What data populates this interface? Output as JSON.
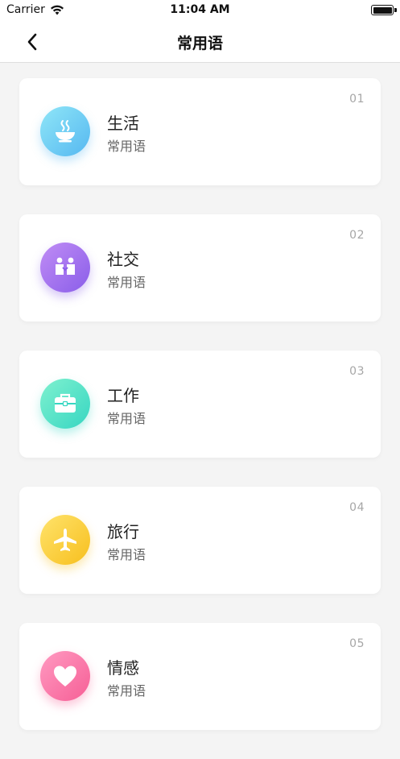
{
  "status_bar": {
    "carrier": "Carrier",
    "time": "11:04 AM"
  },
  "nav": {
    "title": "常用语"
  },
  "categories": [
    {
      "number": "01",
      "name": "生活",
      "subtitle": "常用语",
      "icon": "bowl-icon",
      "color_from": "#8fe6f7",
      "color_to": "#56b8f1"
    },
    {
      "number": "02",
      "name": "社交",
      "subtitle": "常用语",
      "icon": "people-icon",
      "color_from": "#c08cf5",
      "color_to": "#8a5ee9"
    },
    {
      "number": "03",
      "name": "工作",
      "subtitle": "常用语",
      "icon": "briefcase-icon",
      "color_from": "#7ff1cf",
      "color_to": "#37d6c2"
    },
    {
      "number": "04",
      "name": "旅行",
      "subtitle": "常用语",
      "icon": "airplane-icon",
      "color_from": "#ffe36b",
      "color_to": "#f7bf1e"
    },
    {
      "number": "05",
      "name": "情感",
      "subtitle": "常用语",
      "icon": "heart-icon",
      "color_from": "#ff9ac1",
      "color_to": "#f65f96"
    }
  ]
}
